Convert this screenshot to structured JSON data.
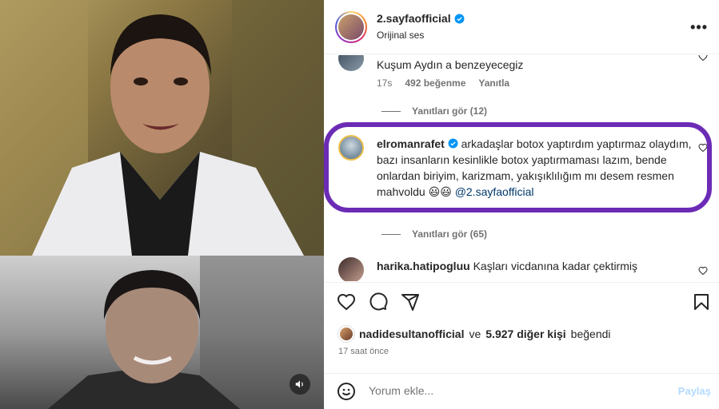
{
  "post": {
    "username": "2.sayfaofficial",
    "audio": "Orijinal ses",
    "more_icon": "more-horizontal-icon"
  },
  "comments": [
    {
      "text": "Kuşum Aydın a benzeyecegiz",
      "time": "17s",
      "likes": "492 beğenme",
      "reply": "Yanıtla"
    },
    {
      "view_replies": "Yanıtları gör (12)"
    },
    {
      "username": "elromanrafet",
      "text": "arkadaşlar botox yaptırdım yaptırmaz olaydım, bazı insanların kesinlikle botox yaptırmaması lazım, bende onlardan biriyim, karizmam, yakışıklılığım mı desem resmen mahvoldu",
      "emoji": "😃😃",
      "mention": "@2.sayfaofficial"
    },
    {
      "view_replies": "Yanıtları gör (65)"
    },
    {
      "username": "harika.hatipogluu",
      "text": "Kaşları vicdanına kadar çektirmiş"
    }
  ],
  "actions": {
    "liked_by_user": "nadidesultanofficial",
    "liked_and": "ve",
    "liked_count": "5.927 diğer kişi",
    "liked_suffix": "beğendi",
    "time_ago": "17 saat önce"
  },
  "comment_input": {
    "placeholder": "Yorum ekle...",
    "post_label": "Paylaş"
  },
  "colors": {
    "highlight": "#6b2bb5",
    "link": "#00376b",
    "verified": "#0095f6"
  }
}
